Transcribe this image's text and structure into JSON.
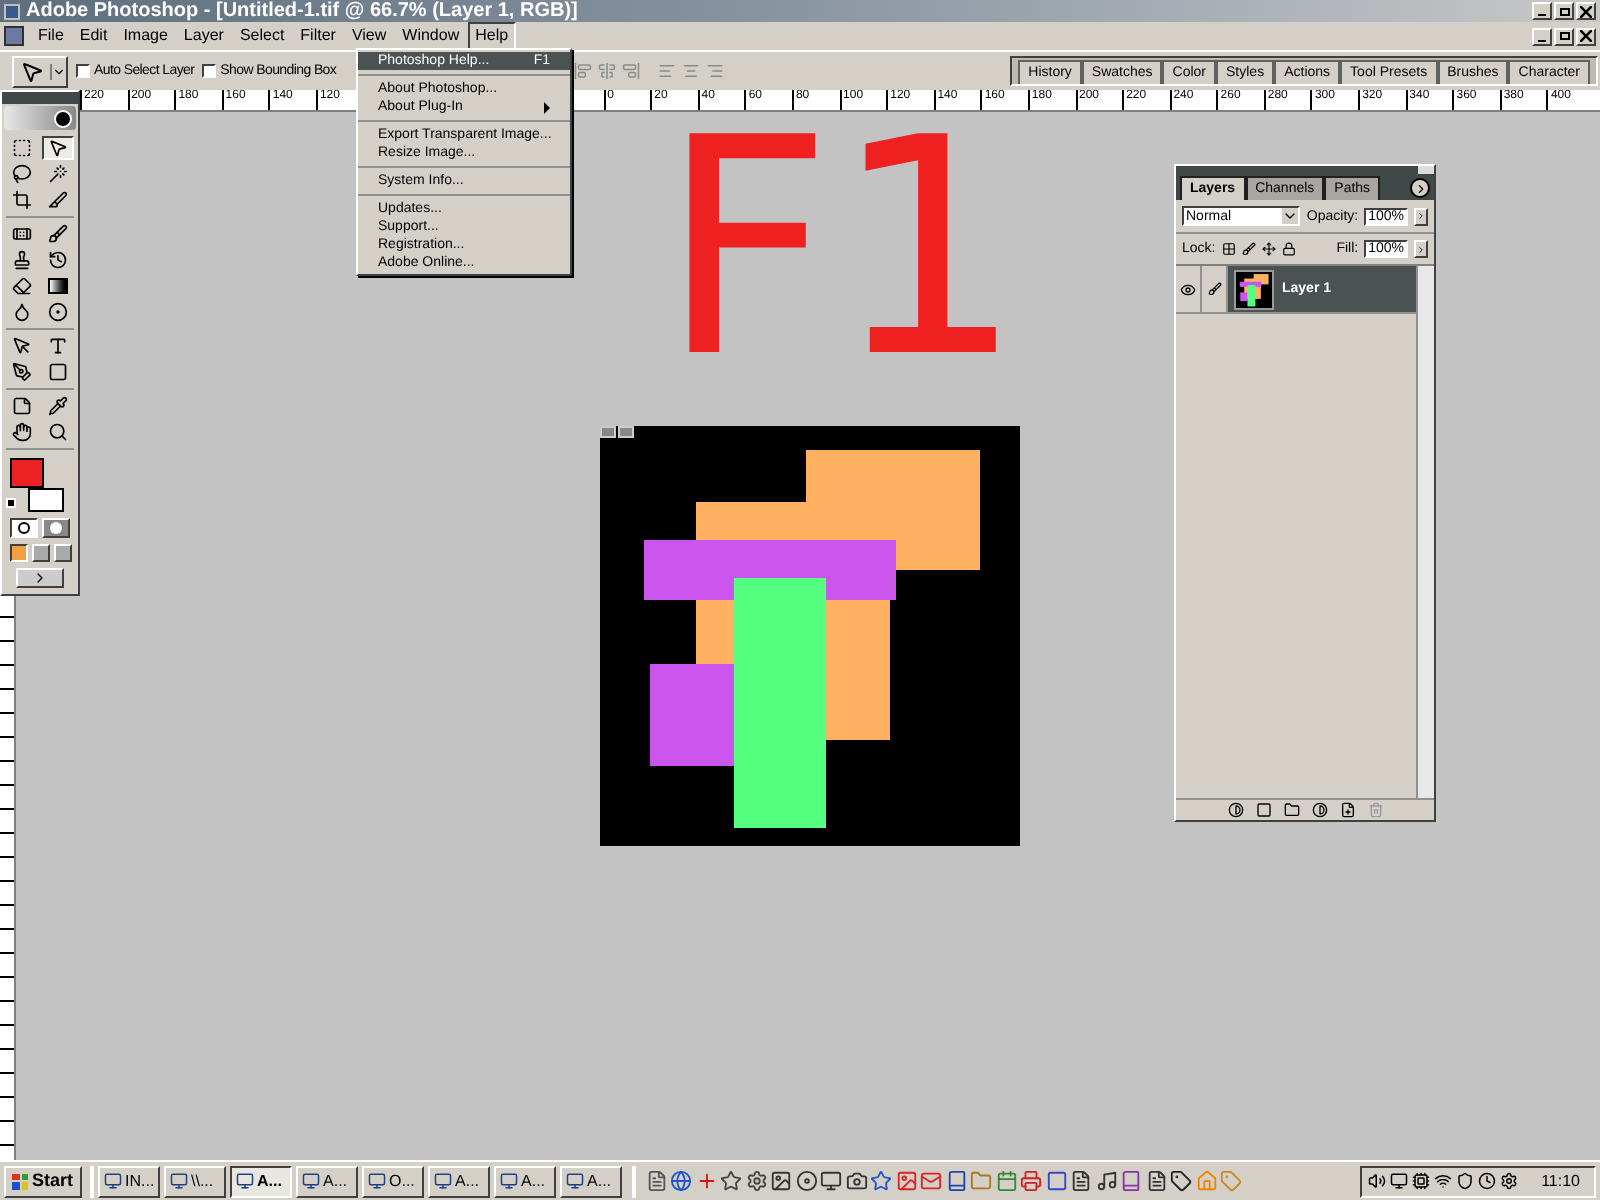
{
  "window": {
    "title": "Adobe Photoshop - [Untitled-1.tif @ 66.7% (Layer 1, RGB)]"
  },
  "menu": [
    {
      "label": "File",
      "selected": false
    },
    {
      "label": "Edit",
      "selected": false
    },
    {
      "label": "Image",
      "selected": false
    },
    {
      "label": "Layer",
      "selected": false
    },
    {
      "label": "Select",
      "selected": false
    },
    {
      "label": "Filter",
      "selected": false
    },
    {
      "label": "View",
      "selected": false
    },
    {
      "label": "Window",
      "selected": false
    },
    {
      "label": "Help",
      "selected": true
    }
  ],
  "help_menu": {
    "groups": [
      [
        {
          "label": "Photoshop Help...",
          "shortcut": "F1",
          "selected": true,
          "submenu": false
        }
      ],
      [
        {
          "label": "About Photoshop...",
          "selected": false,
          "submenu": false
        },
        {
          "label": "About Plug-In",
          "selected": false,
          "submenu": true
        }
      ],
      [
        {
          "label": "Export Transparent Image...",
          "selected": false,
          "submenu": false
        },
        {
          "label": "Resize Image...",
          "selected": false,
          "submenu": false
        }
      ],
      [
        {
          "label": "System Info...",
          "selected": false,
          "submenu": false
        }
      ],
      [
        {
          "label": "Updates...",
          "selected": false,
          "submenu": false
        },
        {
          "label": "Support...",
          "selected": false,
          "submenu": false
        },
        {
          "label": "Registration...",
          "selected": false,
          "submenu": false
        },
        {
          "label": "Adobe Online...",
          "selected": false,
          "submenu": false
        }
      ]
    ]
  },
  "options_bar": {
    "checkboxes": [
      {
        "label": "Auto Select Layer",
        "checked": false
      },
      {
        "label": "Show Bounding Box",
        "checked": false
      }
    ]
  },
  "palette_well": {
    "tabs": [
      "History",
      "Swatches",
      "Color",
      "Styles",
      "Actions",
      "Tool Presets",
      "Brushes",
      "Character"
    ]
  },
  "ruler": {
    "left_labels": [
      "220",
      "200",
      "180",
      "160",
      "140",
      "120"
    ],
    "right_labels": [
      "0",
      "20",
      "40",
      "60",
      "80",
      "100",
      "120",
      "140",
      "160",
      "180",
      "200",
      "220",
      "240",
      "260",
      "280",
      "300",
      "320",
      "340",
      "360",
      "380",
      "400"
    ]
  },
  "annotation": {
    "text": "F1"
  },
  "toolbox": {
    "tool_groups": [
      [
        {
          "kind": "marquee",
          "selected": false
        },
        {
          "kind": "move",
          "selected": true
        },
        {
          "kind": "lasso",
          "selected": false
        },
        {
          "kind": "wand",
          "selected": false
        },
        {
          "kind": "crop",
          "selected": false
        },
        {
          "kind": "slice",
          "selected": false
        }
      ],
      [
        {
          "kind": "heal",
          "selected": false
        },
        {
          "kind": "brush",
          "selected": false
        },
        {
          "kind": "stamp",
          "selected": false
        },
        {
          "kind": "history",
          "selected": false
        },
        {
          "kind": "eraser",
          "selected": false
        },
        {
          "kind": "gradient",
          "selected": false
        },
        {
          "kind": "blur",
          "selected": false
        },
        {
          "kind": "dodge",
          "selected": false
        }
      ],
      [
        {
          "kind": "path",
          "selected": false
        },
        {
          "kind": "type",
          "selected": false
        },
        {
          "kind": "pen",
          "selected": false
        },
        {
          "kind": "shape",
          "selected": false
        }
      ],
      [
        {
          "kind": "notes",
          "selected": false
        },
        {
          "kind": "eyedropper",
          "selected": false
        },
        {
          "kind": "hand",
          "selected": false
        },
        {
          "kind": "zoom",
          "selected": false
        }
      ]
    ],
    "color_swatches": [
      {
        "kind": "foreground",
        "color": "#ee2222"
      },
      {
        "kind": "background",
        "color": "#ffffff"
      }
    ]
  },
  "layers_panel": {
    "tabs": [
      {
        "label": "Layers",
        "selected": true
      },
      {
        "label": "Channels",
        "selected": false
      },
      {
        "label": "Paths",
        "selected": false
      }
    ],
    "blend_mode": "Normal",
    "opacity_label": "Opacity:",
    "opacity": "100%",
    "lock_label": "Lock:",
    "fill_label": "Fill:",
    "fill": "100%",
    "layers": [
      {
        "name": "Layer 1",
        "selected": true,
        "visible": true
      }
    ]
  },
  "taskbar": {
    "start": "Start",
    "tasks": [
      {
        "label": "IN...",
        "selected": false
      },
      {
        "label": "\\\\...",
        "selected": false
      },
      {
        "label": "A...",
        "selected": true
      },
      {
        "label": "A...",
        "selected": false
      },
      {
        "label": "O...",
        "selected": false
      },
      {
        "label": "A...",
        "selected": false
      },
      {
        "label": "A...",
        "selected": false
      },
      {
        "label": "A...",
        "selected": false
      }
    ],
    "clock": "11:10"
  }
}
